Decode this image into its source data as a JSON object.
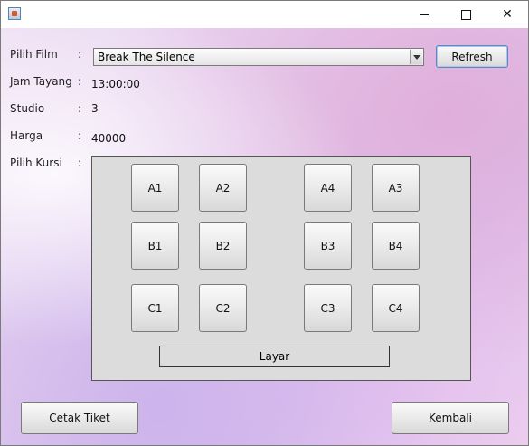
{
  "window": {
    "controls": {
      "minimize": "—",
      "maximize": "☐",
      "close": "✕"
    }
  },
  "form": {
    "film_label": "Pilih Film",
    "film_colon": ":",
    "film_selected": "Break The Silence",
    "refresh_label": "Refresh",
    "time_label": "Jam Tayang",
    "time_colon": ":",
    "time_value": "13:00:00",
    "studio_label": "Studio",
    "studio_colon": ":",
    "studio_value": "3",
    "price_label": "Harga",
    "price_colon": ":",
    "price_value": "40000",
    "seat_label": "Pilih Kursi",
    "seat_colon": ":"
  },
  "seats": {
    "A1": "A1",
    "A2": "A2",
    "A4": "A4",
    "A3": "A3",
    "B1": "B1",
    "B2": "B2",
    "B3": "B3",
    "B4": "B4",
    "C1": "C1",
    "C2": "C2",
    "C3": "C3",
    "C4": "C4",
    "screen": "Layar"
  },
  "footer": {
    "print_label": "Cetak Tiket",
    "back_label": "Kembali"
  },
  "colors": {
    "focus_border": "#5e87c2",
    "panel_bg": "#dcdcdc"
  },
  "icons": {
    "app": "java-app-icon",
    "dropdown": "chevron-down-icon"
  }
}
